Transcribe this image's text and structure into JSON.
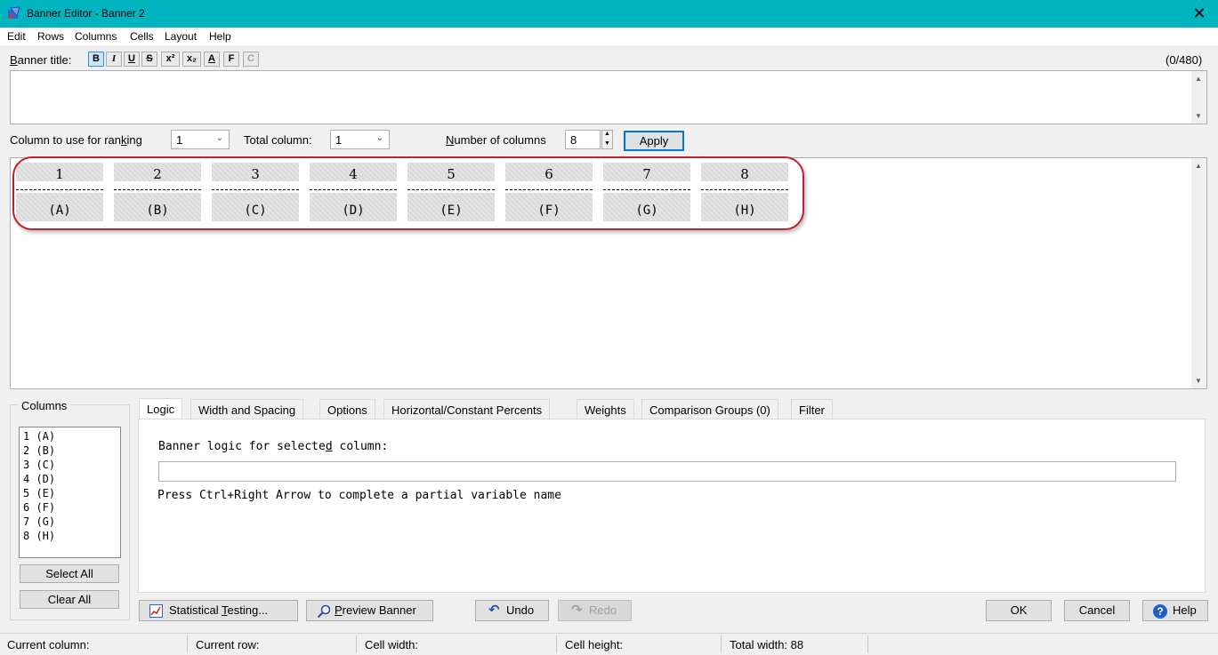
{
  "window": {
    "title": "Banner Editor - Banner 2",
    "close_glyph": "✕"
  },
  "menu": [
    "Edit",
    "Rows",
    "Columns",
    "Cells",
    "Layout",
    "Help"
  ],
  "banner_title": {
    "label_pre": "",
    "label_u": "B",
    "label_post": "anner title:",
    "counter": "(0/480)",
    "format_buttons": [
      "B",
      "I",
      "U",
      "S",
      "x²",
      "x₂",
      "A",
      "F",
      "C"
    ]
  },
  "ranking": {
    "label_pre": "Column to use for ran",
    "label_u": "k",
    "label_post": "ing",
    "value": "1"
  },
  "total_column": {
    "label": "Total column:",
    "value": "1"
  },
  "number_of_columns": {
    "label_u": "N",
    "label_post": "umber of columns",
    "value": "8"
  },
  "apply_label": "Apply",
  "banner_columns": [
    {
      "num": "1",
      "letter": "(A)"
    },
    {
      "num": "2",
      "letter": "(B)"
    },
    {
      "num": "3",
      "letter": "(C)"
    },
    {
      "num": "4",
      "letter": "(D)"
    },
    {
      "num": "5",
      "letter": "(E)"
    },
    {
      "num": "6",
      "letter": "(F)"
    },
    {
      "num": "7",
      "letter": "(G)"
    },
    {
      "num": "8",
      "letter": "(H)"
    }
  ],
  "columns_panel": {
    "title": "Columns",
    "items": [
      "1 (A)",
      "2 (B)",
      "3 (C)",
      "4 (D)",
      "5 (E)",
      "6 (F)",
      "7 (G)",
      "8 (H)"
    ],
    "select_all": "Select All",
    "clear_all": "Clear All"
  },
  "tabs": [
    "Logic",
    "Width and Spacing",
    "Options",
    "Horizontal/Constant Percents",
    "Weights",
    "Comparison Groups (0)",
    "Filter"
  ],
  "logic": {
    "label_pre": "Banner logic for selecte",
    "label_u": "d",
    "label_post": " column:",
    "value": "",
    "hint": "Press Ctrl+Right Arrow to complete a partial variable name"
  },
  "buttons": {
    "statistical_pre": "Statistical ",
    "statistical_u": "T",
    "statistical_post": "esting...",
    "preview_u": "P",
    "preview_post": "review Banner",
    "undo": "Undo",
    "redo": "Redo",
    "ok": "OK",
    "cancel": "Cancel",
    "help": "Help"
  },
  "status": {
    "current_column": "Current column:",
    "current_row": "Current row:",
    "cell_width": "Cell width:",
    "cell_height": "Cell height:",
    "total_width": "Total width: 88"
  },
  "colors": {
    "titlebar": "#00b4c0",
    "highlight": "#c0202c",
    "accent": "#0078d7"
  }
}
